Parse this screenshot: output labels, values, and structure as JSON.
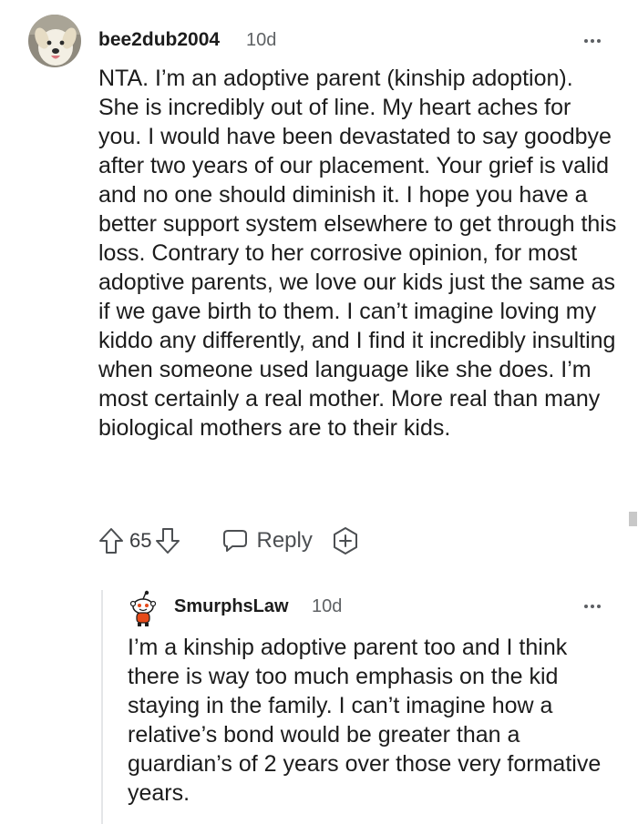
{
  "comment": {
    "username": "bee2dub2004",
    "age": "10d",
    "body": "NTA. I’m an adoptive parent (kinship adoption). She is incredibly out of line. My heart aches for you. I would have been devastated to say goodbye after two years of our placement. Your grief is valid and no one should diminish it. I hope you have a better support system elsewhere to get through this loss. Contrary to her corrosive opinion, for most adoptive parents, we love our kids just the same as if we gave birth to them. I can’t imagine loving my kiddo any differently, and I find it incredibly insulting when someone used language like she does. I’m most certainly a real mother. More real than many biological mothers are to their kids.",
    "score": "65",
    "reply_label": "Reply",
    "avatar_icon": "dog-avatar",
    "upvote_icon": "arrow-up-icon",
    "downvote_icon": "arrow-down-icon",
    "reply_icon": "chat-bubble-icon",
    "award_icon": "award-plus-icon",
    "more_icon": "more-options-icon"
  },
  "reply": {
    "username": "SmurphsLaw",
    "age": "10d",
    "body": "I’m a kinship adoptive parent too and I think there is way too much emphasis on the kid staying in the family. I can’t imagine how a relative’s bond would be greater than a guardian’s of 2 years over those very formative years.",
    "avatar_icon": "snoo-avatar"
  },
  "colors": {
    "text": "#1c1c1c",
    "meta": "#5f6265",
    "icon": "#4c4f52",
    "thread_line": "#e4e6e8"
  }
}
